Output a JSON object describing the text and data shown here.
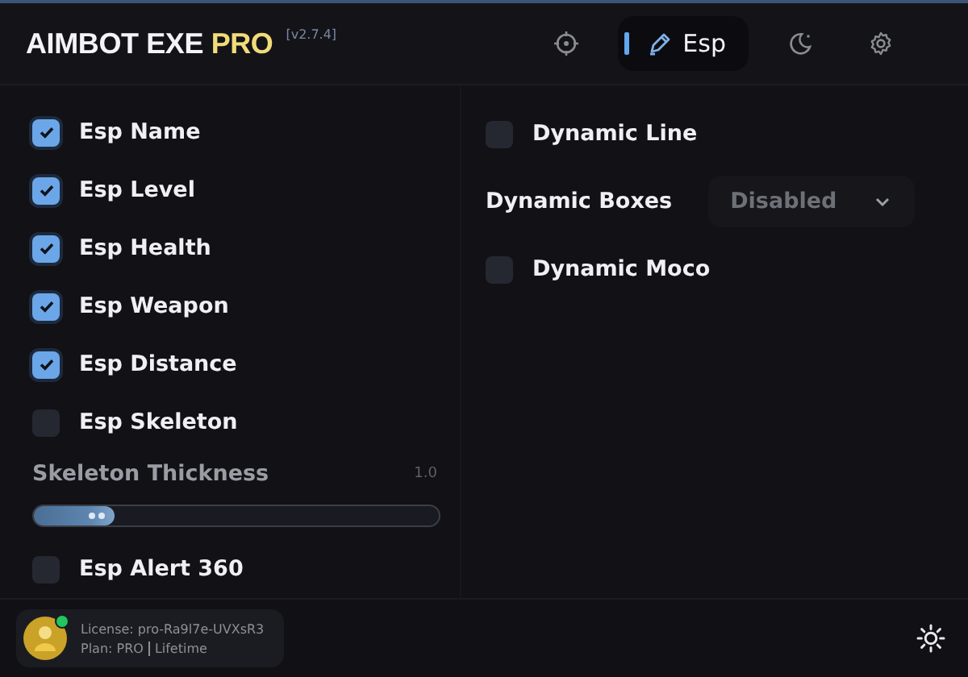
{
  "app": {
    "title": "AIMBOT EXE",
    "title_accent": "PRO",
    "version": "[v2.7.4]"
  },
  "tabs": [
    {
      "kind": "crosshair",
      "selected": false
    },
    {
      "kind": "pen",
      "label": "Esp",
      "selected": true
    },
    {
      "kind": "moon",
      "selected": false
    },
    {
      "kind": "gear",
      "selected": false
    }
  ],
  "left_options": [
    {
      "kind": "checkbox",
      "label": "Esp Name",
      "checked": true
    },
    {
      "kind": "checkbox",
      "label": "Esp Level",
      "checked": true
    },
    {
      "kind": "checkbox",
      "label": "Esp Health",
      "checked": true
    },
    {
      "kind": "checkbox",
      "label": "Esp Weapon",
      "checked": true
    },
    {
      "kind": "checkbox",
      "label": "Esp Distance",
      "checked": true
    },
    {
      "kind": "checkbox",
      "label": "Esp Skeleton",
      "checked": false
    },
    {
      "kind": "slider",
      "label": "Skeleton Thickness",
      "reading": "1.0"
    },
    {
      "kind": "checkbox",
      "label": "Esp Alert 360",
      "checked": false
    }
  ],
  "right_options": [
    {
      "kind": "checkbox",
      "label": "Dynamic Line",
      "checked": false
    },
    {
      "kind": "dropdown",
      "label": "Dynamic Boxes",
      "value": "Disabled"
    },
    {
      "kind": "checkbox",
      "label": "Dynamic Moco",
      "checked": false
    }
  ],
  "footer": {
    "online": true,
    "license": "License: pro-Ra9l7e-UVXsR3",
    "plan_prefix": "Plan:",
    "plan": "PRO",
    "plan_term": "Lifetime"
  }
}
